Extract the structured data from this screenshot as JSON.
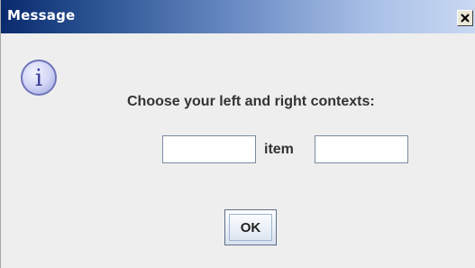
{
  "dialog": {
    "title": "Message",
    "close_icon": "close-icon",
    "info_icon": "info-icon",
    "info_symbol": "i",
    "message": "Choose your left and right contexts:",
    "left_context_value": "",
    "right_context_value": "",
    "separator_label": "item",
    "ok_label": "OK"
  },
  "colors": {
    "titlebar_start": "#0a2a6e",
    "titlebar_end": "#c9d9f2",
    "background": "#eeeeee",
    "icon_fill": "#c8cdf0",
    "icon_stroke": "#6e74b8"
  }
}
